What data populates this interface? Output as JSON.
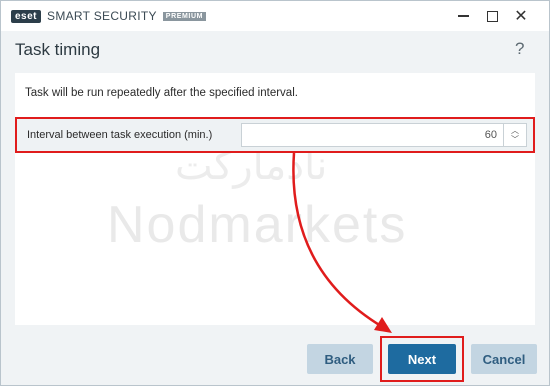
{
  "titlebar": {
    "logo": "eset",
    "product": "SMART SECURITY",
    "edition": "PREMIUM",
    "controls": {
      "minimize_icon": "minimize-icon",
      "maximize_icon": "maximize-icon",
      "close_icon": "close-icon"
    }
  },
  "header": {
    "title": "Task timing",
    "help": "?"
  },
  "content": {
    "description": "Task will be run repeatedly after the specified interval.",
    "interval": {
      "label": "Interval between task execution (min.)",
      "value": "60"
    }
  },
  "watermark": {
    "arabic": "نادمارکت",
    "latin": "Nodmarkets"
  },
  "footer": {
    "back_label": "Back",
    "next_label": "Next",
    "cancel_label": "Cancel"
  },
  "colors": {
    "highlight": "#e01c1c",
    "primary_button": "#1e6ba0",
    "secondary_button": "#c3d5e2"
  }
}
